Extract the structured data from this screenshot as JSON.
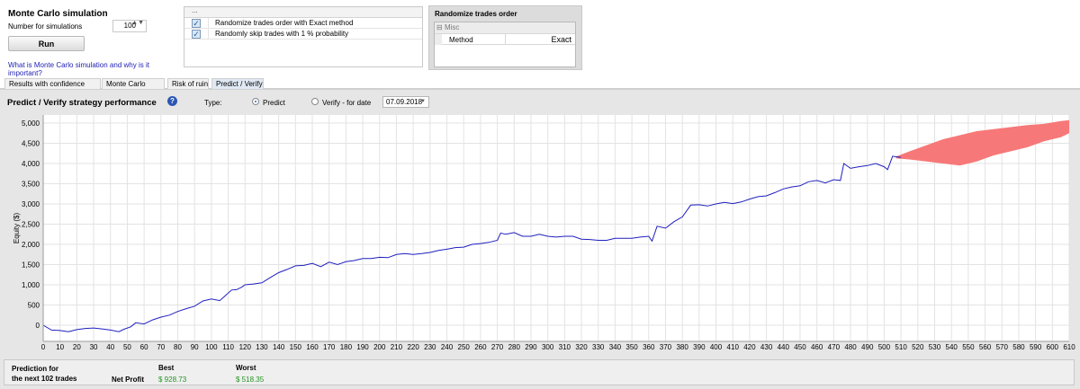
{
  "mc": {
    "title": "Monte Carlo simulation",
    "num_label": "Number for simulations",
    "num_value": "100",
    "spin": "▲▼",
    "run_label": "Run",
    "link_text": "What is Monte Carlo simulation and why is it important?"
  },
  "options": {
    "header": "...",
    "items": [
      {
        "label": "Randomize trades order with Exact method",
        "checked": true
      },
      {
        "label": "Randomly skip trades with 1 % probability",
        "checked": true
      }
    ],
    "check_glyph": "✓"
  },
  "rto": {
    "title": "Randomize trades order",
    "category": "Misc",
    "key": "Method",
    "value": "Exact"
  },
  "tabs": [
    {
      "label": "Results with confidence levels",
      "active": false
    },
    {
      "label": "Monte Carlo Chart",
      "active": false
    },
    {
      "label": "Risk of ruin",
      "active": false
    },
    {
      "label": "Predict / Verify",
      "active": true
    }
  ],
  "predict_verify": {
    "title": "Predict / Verify strategy performance",
    "help_icon": "?",
    "type_label": "Type:",
    "predict_label": "Predict",
    "verify_label": "Verify - for date",
    "date_value": "07.09.2018",
    "date_arrow": "▼",
    "predict_selected": true
  },
  "chart_data": {
    "type": "area",
    "ylabel": "Equity ($)",
    "xlabel": "",
    "xlim": [
      0,
      610
    ],
    "ylim": [
      -400,
      5200
    ],
    "x_ticks": [
      0,
      10,
      20,
      30,
      40,
      50,
      60,
      70,
      80,
      90,
      100,
      110,
      120,
      130,
      140,
      150,
      160,
      170,
      180,
      190,
      200,
      210,
      220,
      230,
      240,
      250,
      260,
      270,
      280,
      290,
      300,
      310,
      320,
      330,
      340,
      350,
      360,
      370,
      380,
      390,
      400,
      410,
      420,
      430,
      440,
      450,
      460,
      470,
      480,
      490,
      500,
      510,
      520,
      530,
      540,
      550,
      560,
      570,
      580,
      590,
      600,
      610
    ],
    "y_ticks": [
      0,
      500,
      1000,
      1500,
      2000,
      2500,
      3000,
      3500,
      4000,
      4500,
      5000
    ],
    "y_tick_labels": [
      "0",
      "500",
      "1,000",
      "1,500",
      "2,000",
      "2,500",
      "3,000",
      "3,500",
      "4,000",
      "4,500",
      "5,000"
    ],
    "grid": true,
    "series": [
      {
        "kind": "line",
        "color": "#1f1fbf",
        "x": [
          0,
          5,
          10,
          15,
          20,
          25,
          30,
          35,
          40,
          45,
          48,
          52,
          55,
          60,
          65,
          70,
          75,
          80,
          85,
          90,
          95,
          100,
          105,
          108,
          112,
          115,
          118,
          120,
          125,
          130,
          135,
          140,
          145,
          150,
          155,
          160,
          165,
          170,
          175,
          180,
          185,
          190,
          195,
          200,
          205,
          210,
          215,
          220,
          225,
          230,
          235,
          240,
          245,
          250,
          255,
          260,
          265,
          270,
          272,
          275,
          280,
          285,
          290,
          295,
          300,
          305,
          310,
          315,
          320,
          325,
          330,
          335,
          340,
          345,
          350,
          355,
          360,
          362,
          365,
          370,
          375,
          380,
          385,
          390,
          395,
          400,
          405,
          410,
          415,
          420,
          425,
          430,
          435,
          440,
          445,
          450,
          455,
          460,
          465,
          470,
          474,
          476,
          480,
          485,
          490,
          495,
          500,
          502,
          505,
          510
        ],
        "y": [
          0,
          -120,
          -130,
          -160,
          -110,
          -80,
          -70,
          -90,
          -120,
          -160,
          -100,
          -40,
          60,
          30,
          130,
          200,
          250,
          340,
          410,
          470,
          600,
          650,
          610,
          720,
          870,
          880,
          940,
          1000,
          1020,
          1050,
          1180,
          1300,
          1380,
          1470,
          1480,
          1530,
          1450,
          1560,
          1500,
          1570,
          1600,
          1650,
          1650,
          1680,
          1670,
          1750,
          1770,
          1750,
          1770,
          1800,
          1850,
          1880,
          1920,
          1930,
          2000,
          2020,
          2050,
          2100,
          2280,
          2250,
          2290,
          2200,
          2200,
          2250,
          2200,
          2180,
          2200,
          2200,
          2130,
          2120,
          2100,
          2100,
          2150,
          2150,
          2150,
          2180,
          2200,
          2080,
          2450,
          2400,
          2560,
          2680,
          2970,
          2980,
          2950,
          3000,
          3040,
          3010,
          3050,
          3120,
          3180,
          3200,
          3280,
          3370,
          3420,
          3450,
          3550,
          3580,
          3520,
          3600,
          3580,
          4000,
          3880,
          3920,
          3950,
          4000,
          3920,
          3850,
          4180,
          4150
        ]
      },
      {
        "kind": "band",
        "color": "#f77878",
        "x": [
          507,
          515,
          525,
          535,
          545,
          555,
          565,
          575,
          585,
          595,
          605,
          610
        ],
        "upper": [
          4170,
          4300,
          4450,
          4600,
          4700,
          4800,
          4850,
          4900,
          4950,
          4980,
          5050,
          5070
        ],
        "lower": [
          4130,
          4100,
          4050,
          4000,
          3950,
          4050,
          4200,
          4300,
          4400,
          4550,
          4650,
          4750
        ]
      }
    ]
  },
  "summary": {
    "pred_line1": "Prediction for",
    "pred_line2": "the next 102 trades",
    "net_profit_label": "Net Profit",
    "best_label": "Best",
    "worst_label": "Worst",
    "best_value": "$ 928.73",
    "worst_value": "$ 518.35"
  }
}
